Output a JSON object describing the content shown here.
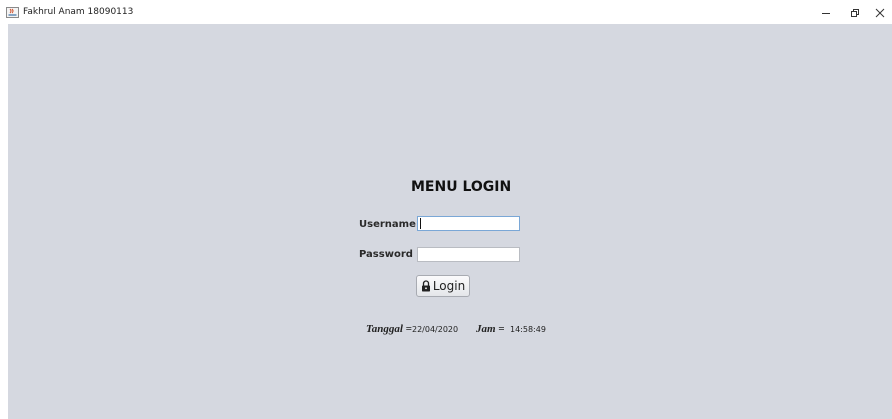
{
  "window": {
    "title": "Fakhrul Anam 18090113",
    "icon": "java-app-icon",
    "controls": [
      "minimize-icon",
      "restore-icon",
      "close-icon"
    ]
  },
  "login": {
    "heading": "MENU LOGIN",
    "username_label": "Username",
    "username_value": "",
    "password_label": "Password",
    "password_value": "",
    "button_label": "Login",
    "button_icon": "lock-icon"
  },
  "info": {
    "tanggal_label": "Tanggal =",
    "tanggal_value": "22/04/2020",
    "jam_label": "Jam =",
    "jam_value": "14:58:49"
  },
  "colors": {
    "background": "#d5d8e0",
    "focus_border": "#7aa7d6"
  }
}
